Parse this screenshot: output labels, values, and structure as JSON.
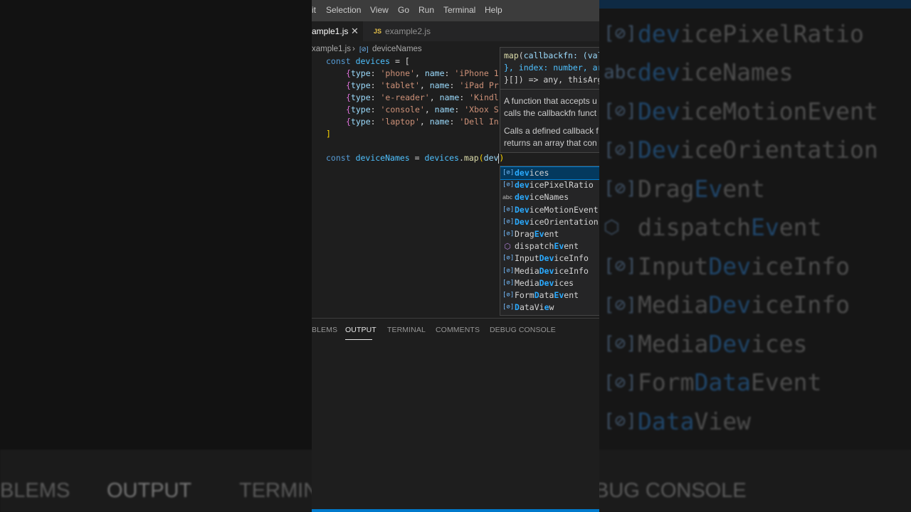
{
  "menu": [
    "it",
    "Selection",
    "View",
    "Go",
    "Run",
    "Terminal",
    "Help"
  ],
  "tabs": [
    {
      "label": "ample1.js",
      "close": "✕"
    },
    {
      "badge": "JS",
      "label": "example2.js"
    }
  ],
  "breadcrumb": {
    "file": "xample1.js",
    "sep": "›",
    "icon": "[⊘]",
    "symbol": "deviceNames"
  },
  "code": {
    "line1": {
      "kw": "const",
      "name": "devices",
      "rest": " = ["
    },
    "items": [
      {
        "type": "'phone'",
        "name": "'iPhone 1"
      },
      {
        "type": "'tablet'",
        "name": "'iPad Pr"
      },
      {
        "type": "'e-reader'",
        "name": "'Kindl"
      },
      {
        "type": "'console'",
        "name": "'Xbox S"
      },
      {
        "type": "'laptop'",
        "name": "'Dell In"
      }
    ],
    "close_bracket": "]",
    "line8": {
      "kw": "const",
      "name": "deviceNames",
      "eq": " = ",
      "obj": "devices",
      "dot": ".",
      "fn": "map",
      "open": "(",
      "arg": "dev",
      "close": ")"
    }
  },
  "hover": {
    "sig1": "map(callbackfn: (val",
    "sig2": "}, index: number, ar",
    "sig3": "}[]) => any, thisArg",
    "doc1": "A function that accepts u",
    "doc2": "calls the callbackfn funct",
    "doc3": "Calls a defined callback f",
    "doc4": "returns an array that con"
  },
  "suggestions": [
    {
      "icon": "[⊘]",
      "kind": "variable",
      "pre": "",
      "match": "dev",
      "post": "ices"
    },
    {
      "icon": "[⊘]",
      "kind": "variable",
      "pre": "",
      "match": "dev",
      "post": "icePixelRatio"
    },
    {
      "icon": "abc",
      "kind": "word",
      "pre": "",
      "match": "dev",
      "post": "iceNames"
    },
    {
      "icon": "[⊘]",
      "kind": "variable",
      "pre": "",
      "match": "Dev",
      "post": "iceMotionEvent"
    },
    {
      "icon": "[⊘]",
      "kind": "variable",
      "pre": "",
      "match": "Dev",
      "post": "iceOrientation"
    },
    {
      "icon": "[⊘]",
      "kind": "variable",
      "pre": "Drag",
      "match": "Ev",
      "post": "ent"
    },
    {
      "icon": "⬡",
      "kind": "method",
      "pre": "dispatch",
      "match": "Ev",
      "post": "ent"
    },
    {
      "icon": "[⊘]",
      "kind": "variable",
      "pre": "Input",
      "match": "Dev",
      "post": "iceInfo"
    },
    {
      "icon": "[⊘]",
      "kind": "variable",
      "pre": "Media",
      "match": "Dev",
      "post": "iceInfo"
    },
    {
      "icon": "[⊘]",
      "kind": "variable",
      "pre": "Media",
      "match": "Dev",
      "post": "ices"
    },
    {
      "icon": "[⊘]",
      "kind": "variable",
      "pre": "Form",
      "match": "D",
      "mid": "ata",
      "match2": "Ev",
      "post": "ent"
    },
    {
      "icon": "[⊘]",
      "kind": "variable",
      "pre": "",
      "match": "D",
      "mid": "ataVi",
      "match2": "e",
      "post": "w"
    }
  ],
  "panel_tabs": [
    "BLEMS",
    "OUTPUT",
    "TERMINAL",
    "COMMENTS",
    "DEBUG CONSOLE"
  ],
  "active_panel_tab": "OUTPUT",
  "background": {
    "items": [
      {
        "icon": "[⊘]",
        "pre": "",
        "match": "dev",
        "post": "icePixelRatio"
      },
      {
        "icon": "abc",
        "pre": "",
        "match": "dev",
        "post": "iceNames"
      },
      {
        "icon": "[⊘]",
        "pre": "",
        "match": "Dev",
        "post": "iceMotionEvent"
      },
      {
        "icon": "[⊘]",
        "pre": "",
        "match": "Dev",
        "post": "iceOrientation"
      },
      {
        "icon": "[⊘]",
        "pre": "Drag",
        "match": "Ev",
        "post": "ent"
      },
      {
        "icon": "⬡",
        "pre": "dispatch",
        "match": "Ev",
        "post": "ent"
      },
      {
        "icon": "[⊘]",
        "pre": "Input",
        "match": "Dev",
        "post": "iceInfo"
      },
      {
        "icon": "[⊘]",
        "pre": "Media",
        "match": "Dev",
        "post": "iceInfo"
      },
      {
        "icon": "[⊘]",
        "pre": "Media",
        "match": "Dev",
        "post": "ices"
      },
      {
        "icon": "[⊘]",
        "pre": "Form",
        "match": "Data",
        "post": "Event"
      },
      {
        "icon": "[⊘]",
        "pre": "",
        "match": "Data",
        "post": "View"
      }
    ],
    "tabs": [
      "BLEMS",
      "OUTPUT",
      "TERMIN",
      "BUG CONSOLE"
    ]
  },
  "colors": {
    "accent": "#007acc",
    "selection": "#04395e",
    "match": "#2aaaff"
  }
}
